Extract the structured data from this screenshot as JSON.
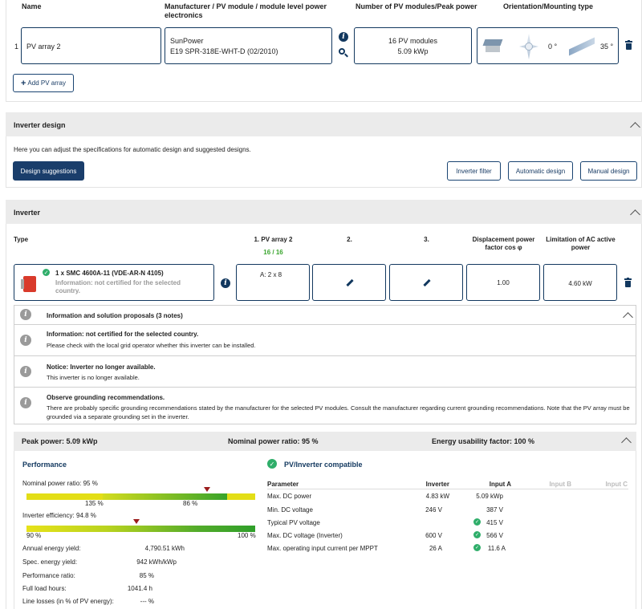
{
  "pv_table": {
    "headers": {
      "name": "Name",
      "manufacturer": "Manufacturer / PV module / module level power electronics",
      "modules": "Number of PV modules/Peak power",
      "orientation": "Orientation/Mounting type"
    },
    "row": {
      "index": "1",
      "name": "PV array 2",
      "manufacturer": "SunPower",
      "module": "E19 SPR-318E-WHT-D (02/2010)",
      "module_count": "16 PV modules",
      "peak_power": "5.09 kWp",
      "azimuth": "0 °",
      "tilt": "35 °"
    },
    "add_button": "Add PV array"
  },
  "inverter_design": {
    "title": "Inverter design",
    "description": "Here you can adjust the specifications for automatic design and suggested designs.",
    "suggestions_button": "Design suggestions",
    "filter_button": "Inverter filter",
    "automatic_button": "Automatic design",
    "manual_button": "Manual design"
  },
  "inverter": {
    "title": "Inverter",
    "headers": {
      "type": "Type",
      "array1": "1. PV array 2",
      "array1_count": "16 / 16",
      "input2": "2.",
      "input3": "3.",
      "cos_phi": "Displacement power factor cos φ",
      "ac_limit": "Limitation of AC active power"
    },
    "row": {
      "model": "1 x SMC 4600A-11 (VDE-AR-N 4105)",
      "info": "Information: not certified for the selected country.",
      "array1_config": "A: 2 x 8",
      "cos_phi": "1.00",
      "ac_limit": "4.60 kW"
    }
  },
  "notes": {
    "header": "Information and solution proposals (3 notes)",
    "items": [
      {
        "title": "Information: not certified for the selected country.",
        "text": "Please check with the local grid operator whether this inverter can be installed."
      },
      {
        "title": "Notice: Inverter no longer available.",
        "text": "This inverter is no longer available."
      },
      {
        "title": "Observe grounding recommendations.",
        "text": "There are probably specific grounding recommendations stated by the manufacturer for the selected PV modules. Consult the manufacturer regarding current grounding recommendations. Note that the PV array must be grounded via a separate grounding set in the inverter."
      }
    ]
  },
  "summary": {
    "peak_power": "Peak power: 5.09 kWp",
    "nominal_ratio": "Nominal power ratio: 95 %",
    "energy_factor": "Energy usability factor: 100 %"
  },
  "performance": {
    "title": "Performance",
    "nominal_label": "Nominal power ratio: 95 %",
    "nominal_left": "135 %",
    "nominal_right": "86 %",
    "efficiency_label": "Inverter efficiency: 94.8 %",
    "eff_left": "90 %",
    "eff_right": "100 %",
    "nominal_marker": 0.79,
    "efficiency_marker": 0.48,
    "stats": [
      {
        "label": "Annual energy yield:",
        "value": "4,790.51 kWh"
      },
      {
        "label": "Spec. energy yield:",
        "value": "942 kWh/kWp"
      },
      {
        "label": "Performance ratio:",
        "value": "85 %"
      },
      {
        "label": "Full load hours:",
        "value": "1041.4 h"
      },
      {
        "label": "Line losses (in % of PV energy):",
        "value": "--- %"
      }
    ]
  },
  "compat": {
    "title": "PV/Inverter compatible",
    "headers": [
      "Parameter",
      "Inverter",
      "Input A",
      "Input B",
      "Input C"
    ],
    "rows": [
      {
        "param": "Max. DC power",
        "inverter": "4.83 kW",
        "a": "5.09 kWp",
        "ok": false
      },
      {
        "param": "Min. DC voltage",
        "inverter": "246 V",
        "a": "387 V",
        "ok": false
      },
      {
        "param": "Typical PV voltage",
        "inverter": "",
        "a": "415 V",
        "ok": true
      },
      {
        "param": "Max. DC voltage (Inverter)",
        "inverter": "600 V",
        "a": "566 V",
        "ok": true
      },
      {
        "param": "Max. operating input current per MPPT",
        "inverter": "26 A",
        "a": "11.6 A",
        "ok": true
      }
    ]
  }
}
